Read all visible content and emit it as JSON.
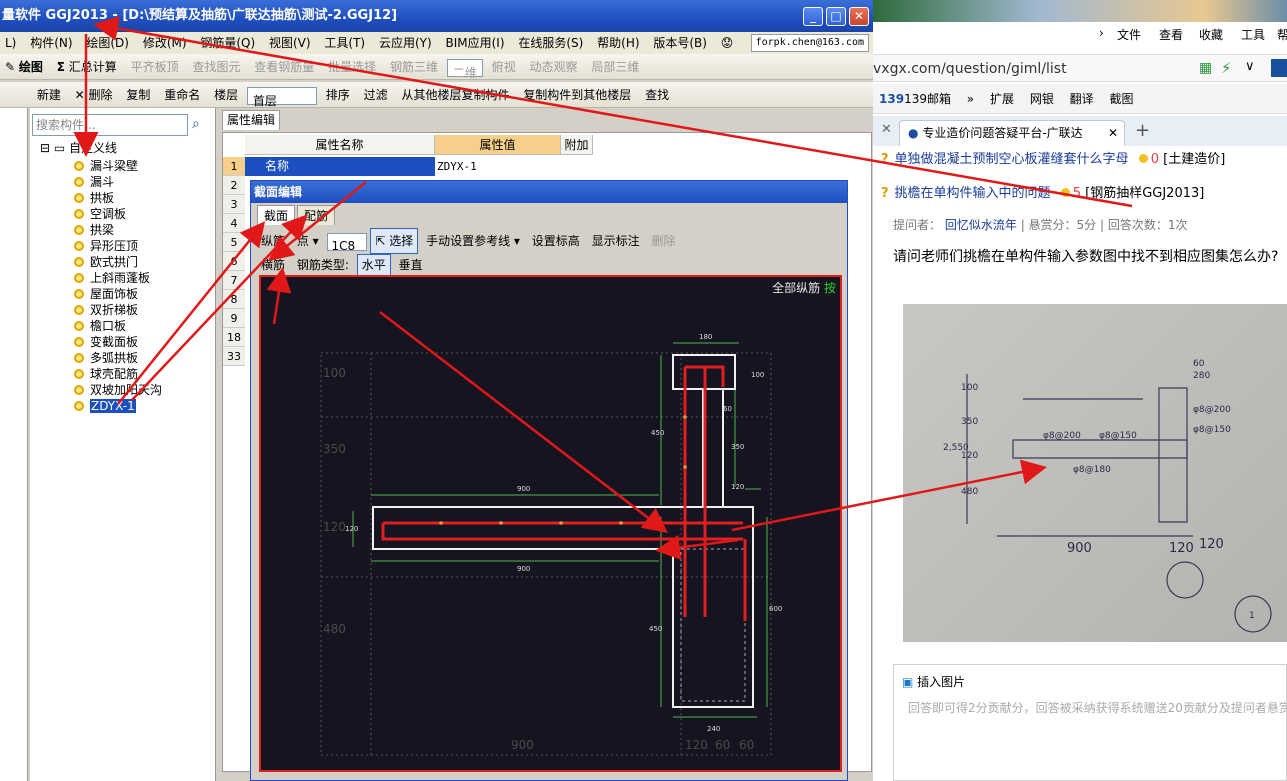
{
  "app": {
    "title": "量软件 GGJ2013 - [D:\\预结算及抽筋\\广联达抽筋\\测试-2.GGJ12]",
    "menus": [
      "L)",
      "构件(N)",
      "绘图(D)",
      "修改(M)",
      "钢筋量(Q)",
      "视图(V)",
      "工具(T)",
      "云应用(Y)",
      "BIM应用(I)",
      "在线服务(S)",
      "帮助(H)",
      "版本号(B)"
    ],
    "user": "forpk.chen@163.com",
    "toolbar1": [
      "绘图",
      "汇总计算",
      "平齐板顶",
      "查找图元",
      "查看钢筋量",
      "批量选择",
      "钢筋三维",
      "二维",
      "俯视",
      "动态观察",
      "局部三维"
    ],
    "toolbar2": [
      "新建",
      "删除",
      "复制",
      "重命名",
      "楼层",
      "首层",
      "排序",
      "过滤",
      "从其他楼层复制构件",
      "复制构件到其他楼层",
      "查找"
    ]
  },
  "tree": {
    "search_placeholder": "搜索构件...",
    "root": "自定义线",
    "items": [
      "漏斗梁壁",
      "漏斗",
      "拱板",
      "空调板",
      "拱梁",
      "异形压顶",
      "欧式拱门",
      "上斜雨蓬板",
      "屋面饰板",
      "双折梯板",
      "檐口板",
      "变截面板",
      "多弧拱板",
      "球壳配筋",
      "双坡加阳天沟"
    ],
    "selected": "ZDYX-1"
  },
  "props": {
    "tab": "属性编辑",
    "col_name": "属性名称",
    "col_value": "属性值",
    "col_extra": "附加",
    "row_numbers": [
      "1",
      "2",
      "3",
      "4",
      "5",
      "6",
      "7",
      "8",
      "9",
      "18",
      "33"
    ],
    "row1_name": "名称",
    "row1_value": "ZDYX-1"
  },
  "dialog": {
    "title": "截面编辑",
    "tab_section": "截面",
    "tab_rebar": "配筋",
    "tool1": [
      "纵筋",
      "点",
      "1C8",
      "选择",
      "手动设置参考线",
      "设置标高",
      "显示标注",
      "删除"
    ],
    "tool2_label": "横筋",
    "rebar_type": "钢筋类型:",
    "horizontal": "水平",
    "vertical": "垂直",
    "canvas_label": "全部纵筋",
    "canvas_label2": "按",
    "dims": {
      "d180": "180",
      "d100a": "100",
      "d60": "60",
      "d450a": "450",
      "d350": "350",
      "d120a": "120",
      "d900a": "900",
      "d120b": "120",
      "d900b": "900",
      "d600": "600",
      "d450b": "450",
      "d240": "240",
      "g100": "100",
      "g350": "350",
      "g120": "120",
      "g480": "480",
      "bottom900": "900",
      "bottom120": "120",
      "bottom60a": "60",
      "bottom60b": "60"
    }
  },
  "browser": {
    "menu": [
      "文件",
      "查看",
      "收藏",
      "工具",
      "帮"
    ],
    "url": "vxgx.com/question/giml/list",
    "bookmarks": [
      "139邮箱",
      "扩展",
      "网银",
      "翻译",
      "截图"
    ],
    "tab_title": "专业造价问题答疑平台-广联达",
    "q1": "单独做混凝土预制空心板灌缝套什么字母",
    "q1_score": "0",
    "q1_tag": "[土建造价]",
    "q2": "挑檐在单构件输入中的问题",
    "q2_score": "5",
    "q2_tag": "[钢筋抽样GGJ2013]",
    "meta_asker_label": "提问者：",
    "meta_asker": "回忆似水流年",
    "meta_reward": "悬赏分：5分",
    "meta_answers": "回答次数：1次",
    "question": "请问老师们挑檐在单构件输入参数图中找不到相应图集怎么办?",
    "img_dims": {
      "v100": "100",
      "v350": "350",
      "v120": "120",
      "v480": "480",
      "v2550": "2,550",
      "h900": "900",
      "h120a": "120",
      "h120b": "120",
      "s60": "60",
      "s280": "280",
      "r1": "φ8@200",
      "r2": "φ8@150",
      "r3": "φ8@180",
      "r4": "φ8@200",
      "r5": "φ8@150",
      "circle": "1"
    },
    "insert_image": "插入图片",
    "answer_placeholder": "回答即可得2分贡献分，回答被采纳获得系统赠送20贡献分及提问者悬赏"
  },
  "colors": {
    "accent": "#1f4fbf",
    "arrow": "#e01818",
    "rebar": "#e02020",
    "dim": "#4fb84f"
  }
}
